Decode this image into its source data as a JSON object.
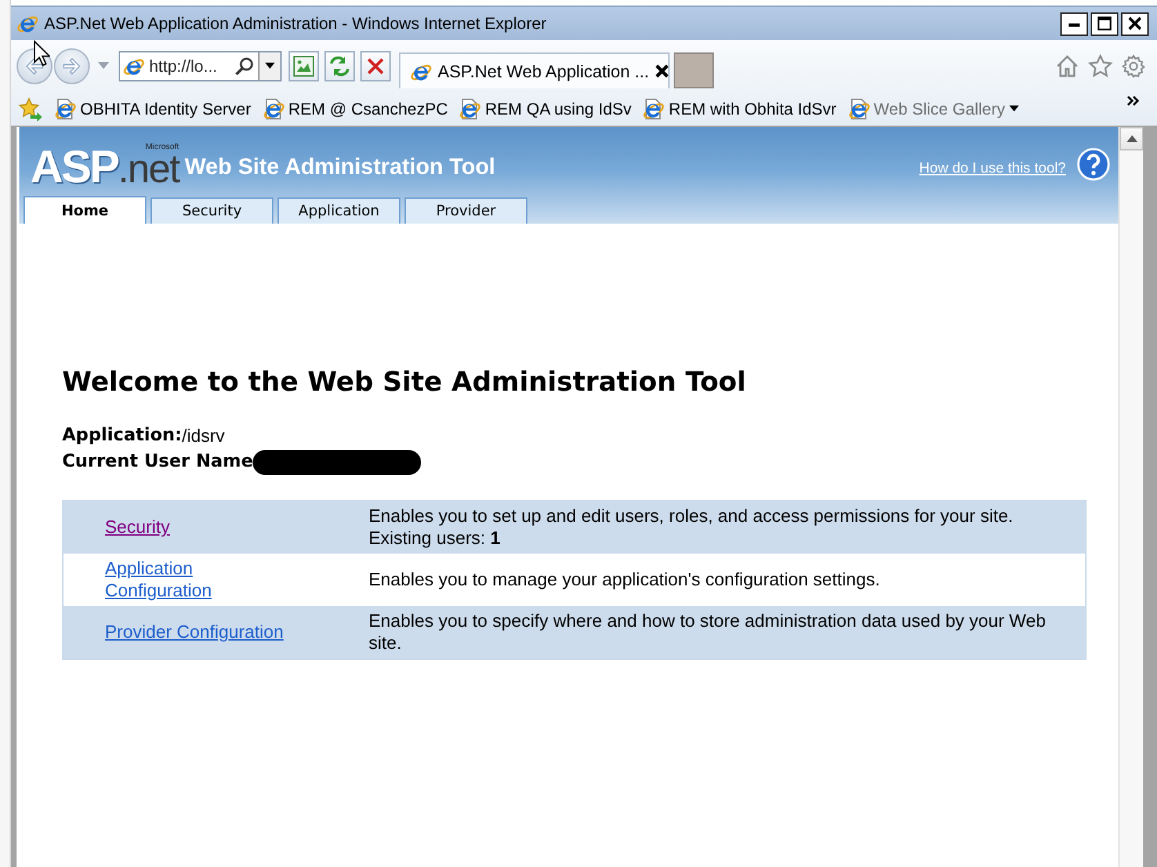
{
  "window": {
    "title": "ASP.Net Web Application Administration - Windows Internet Explorer"
  },
  "address_bar": {
    "value": "http://lo..."
  },
  "browser_tabs": [
    {
      "label": "ASP.Net Web Application ...",
      "selected": true
    }
  ],
  "favorites": [
    {
      "label": "OBHITA Identity Server",
      "kind": "link"
    },
    {
      "label": "REM @ CsanchezPC",
      "kind": "link"
    },
    {
      "label": "REM QA using IdSv",
      "kind": "link"
    },
    {
      "label": "REM with Obhita IdSvr",
      "kind": "link"
    },
    {
      "label": "Web Slice Gallery",
      "kind": "gallery"
    }
  ],
  "site_header": {
    "logo": {
      "vendor": "Microsoft",
      "name": "ASP",
      "suffix": ".net"
    },
    "title": "Web Site Administration Tool",
    "help_link": "How do I use this tool?"
  },
  "site_tabs": [
    {
      "label": "Home",
      "selected": true
    },
    {
      "label": "Security",
      "selected": false
    },
    {
      "label": "Application",
      "selected": false
    },
    {
      "label": "Provider",
      "selected": false
    }
  ],
  "content": {
    "heading": "Welcome to the Web Site Administration Tool",
    "info": [
      {
        "label": "Application:",
        "value": "/idsrv",
        "redacted": false
      },
      {
        "label": "Current User Name",
        "redacted": true
      }
    ],
    "features": [
      {
        "link": "Security",
        "visited": true,
        "description": "Enables you to set up and edit users, roles, and access permissions for your site. Existing users: **1**"
      },
      {
        "link": "Application Configuration",
        "visited": false,
        "description": "Enables you to manage your application's configuration settings."
      },
      {
        "link": "Provider Configuration",
        "visited": false,
        "description": "Enables you to specify where and how to store administration data used by your Web site."
      }
    ]
  }
}
